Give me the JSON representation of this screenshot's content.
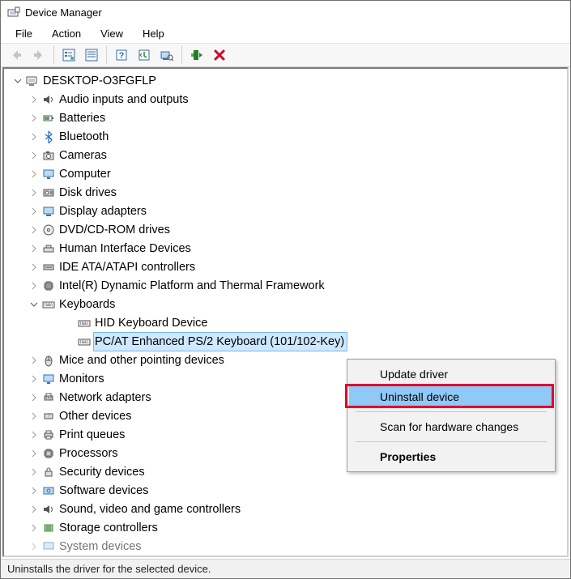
{
  "window": {
    "title": "Device Manager"
  },
  "menu": {
    "file": "File",
    "action": "Action",
    "view": "View",
    "help": "Help"
  },
  "tree": {
    "root": {
      "label": "DESKTOP-O3FGFLP"
    },
    "audio": "Audio inputs and outputs",
    "batteries": "Batteries",
    "bluetooth": "Bluetooth",
    "cameras": "Cameras",
    "computer": "Computer",
    "disks": "Disk drives",
    "display": "Display adapters",
    "dvd": "DVD/CD-ROM drives",
    "hid": "Human Interface Devices",
    "ata": "IDE ATA/ATAPI controllers",
    "intel": "Intel(R) Dynamic Platform and Thermal Framework",
    "keyboards": "Keyboards",
    "keyboards_children": {
      "hid_kbd": "HID Keyboard Device",
      "ps2_kbd": "PC/AT Enhanced PS/2 Keyboard (101/102-Key)"
    },
    "mice": "Mice and other pointing devices",
    "monitors": "Monitors",
    "network": "Network adapters",
    "other": "Other devices",
    "printq": "Print queues",
    "processors": "Processors",
    "security": "Security devices",
    "software": "Software devices",
    "sound": "Sound, video and game controllers",
    "storage": "Storage controllers",
    "system": "System devices"
  },
  "context_menu": {
    "update": "Update driver",
    "uninstall": "Uninstall device",
    "scan": "Scan for hardware changes",
    "properties": "Properties"
  },
  "statusbar": {
    "text": "Uninstalls the driver for the selected device."
  }
}
